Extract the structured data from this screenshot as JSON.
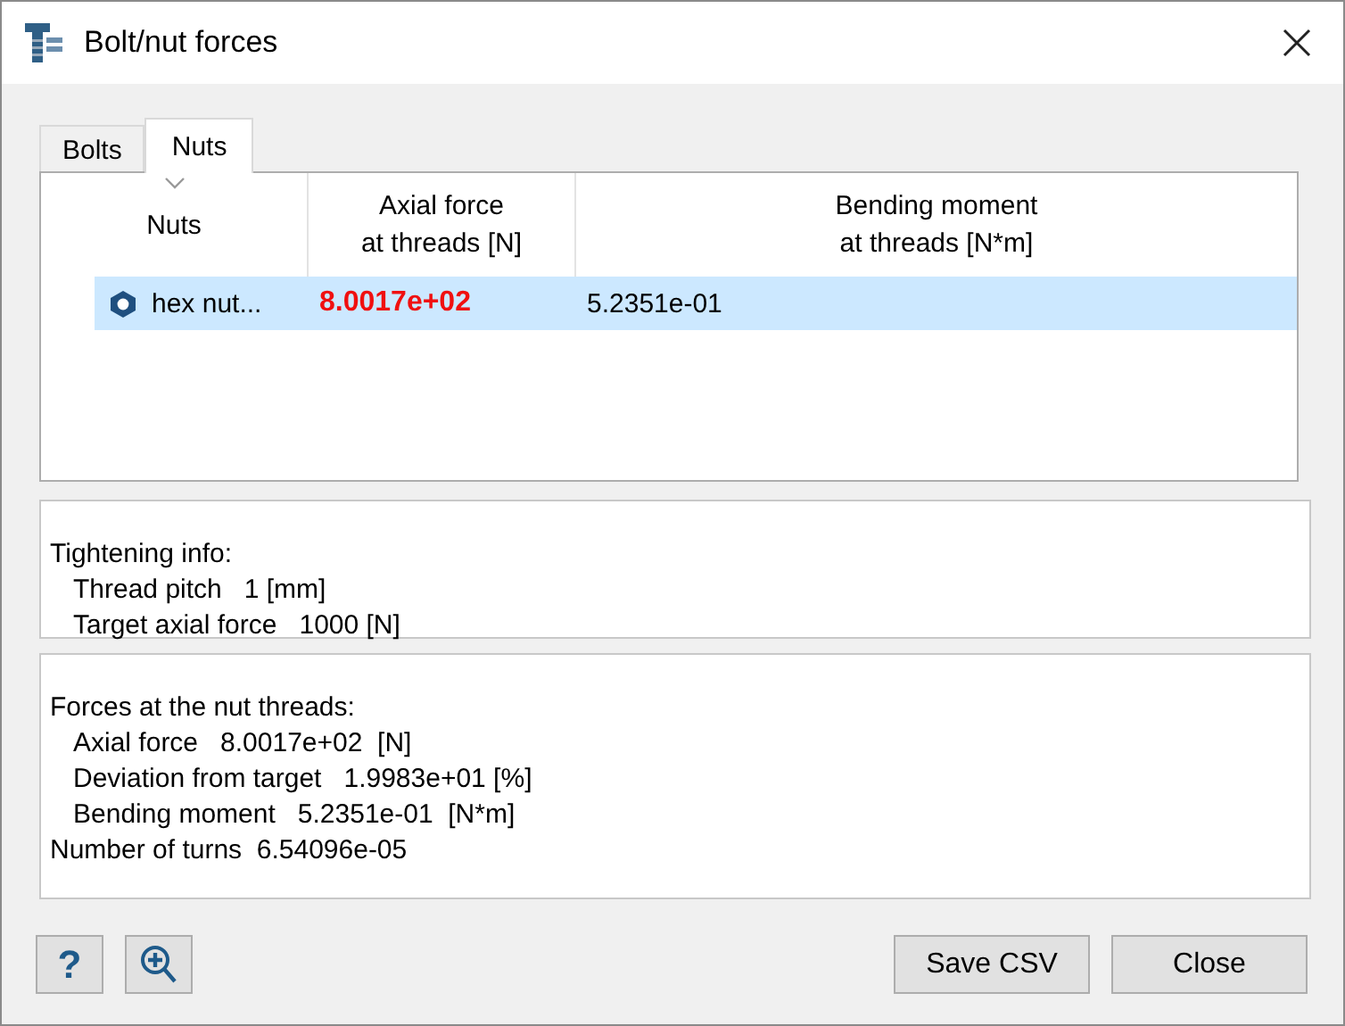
{
  "window": {
    "title": "Bolt/nut forces"
  },
  "tabs": [
    {
      "label": "Bolts",
      "selected": false
    },
    {
      "label": "Nuts",
      "selected": true
    }
  ],
  "table": {
    "columns": [
      {
        "label": "Nuts",
        "sorted": true
      },
      {
        "label": "Axial force\nat threads [N]",
        "sorted": false
      },
      {
        "label": "Bending moment\nat threads [N*m]",
        "sorted": false
      }
    ],
    "rows": [
      {
        "name": "hex nut...",
        "axial_force": "8.0017e+02",
        "axial_warning": true,
        "bending_moment": "5.2351e-01",
        "selected": true
      }
    ]
  },
  "info_panels": [
    {
      "lines": [
        {
          "text": "Tightening info:",
          "children": [
            {
              "text": "Thread pitch   1 [mm]"
            },
            {
              "text": "Target axial force   1000 [N]"
            }
          ]
        }
      ]
    },
    {
      "lines": [
        {
          "text": "Forces at the nut threads:",
          "children": [
            {
              "text": "Axial force   8.0017e+02  [N]"
            },
            {
              "text": "Deviation from target   1.9983e+01 [%]"
            },
            {
              "text": "Bending moment   5.2351e-01  [N*m]"
            }
          ]
        },
        {
          "text": "Number of turns  6.54096e-05"
        }
      ]
    }
  ],
  "buttons": [
    {
      "kind": "help",
      "label": "?"
    },
    {
      "kind": "zoom"
    },
    {
      "kind": "text",
      "label": "Save CSV"
    },
    {
      "kind": "text",
      "label": "Close"
    }
  ]
}
